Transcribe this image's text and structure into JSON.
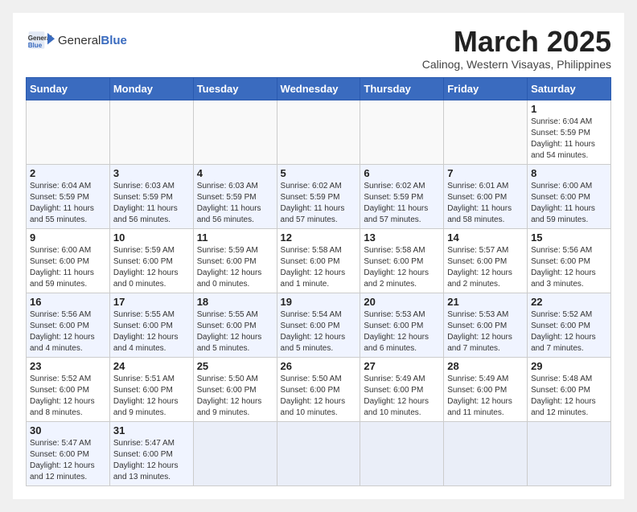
{
  "logo": {
    "text_general": "General",
    "text_blue": "Blue"
  },
  "header": {
    "month_title": "March 2025",
    "subtitle": "Calinog, Western Visayas, Philippines"
  },
  "weekdays": [
    "Sunday",
    "Monday",
    "Tuesday",
    "Wednesday",
    "Thursday",
    "Friday",
    "Saturday"
  ],
  "days": [
    {
      "num": "",
      "info": ""
    },
    {
      "num": "",
      "info": ""
    },
    {
      "num": "",
      "info": ""
    },
    {
      "num": "",
      "info": ""
    },
    {
      "num": "",
      "info": ""
    },
    {
      "num": "",
      "info": ""
    },
    {
      "num": "1",
      "info": "Sunrise: 6:04 AM\nSunset: 5:59 PM\nDaylight: 11 hours\nand 54 minutes."
    },
    {
      "num": "2",
      "info": "Sunrise: 6:04 AM\nSunset: 5:59 PM\nDaylight: 11 hours\nand 55 minutes."
    },
    {
      "num": "3",
      "info": "Sunrise: 6:03 AM\nSunset: 5:59 PM\nDaylight: 11 hours\nand 56 minutes."
    },
    {
      "num": "4",
      "info": "Sunrise: 6:03 AM\nSunset: 5:59 PM\nDaylight: 11 hours\nand 56 minutes."
    },
    {
      "num": "5",
      "info": "Sunrise: 6:02 AM\nSunset: 5:59 PM\nDaylight: 11 hours\nand 57 minutes."
    },
    {
      "num": "6",
      "info": "Sunrise: 6:02 AM\nSunset: 5:59 PM\nDaylight: 11 hours\nand 57 minutes."
    },
    {
      "num": "7",
      "info": "Sunrise: 6:01 AM\nSunset: 6:00 PM\nDaylight: 11 hours\nand 58 minutes."
    },
    {
      "num": "8",
      "info": "Sunrise: 6:00 AM\nSunset: 6:00 PM\nDaylight: 11 hours\nand 59 minutes."
    },
    {
      "num": "9",
      "info": "Sunrise: 6:00 AM\nSunset: 6:00 PM\nDaylight: 11 hours\nand 59 minutes."
    },
    {
      "num": "10",
      "info": "Sunrise: 5:59 AM\nSunset: 6:00 PM\nDaylight: 12 hours\nand 0 minutes."
    },
    {
      "num": "11",
      "info": "Sunrise: 5:59 AM\nSunset: 6:00 PM\nDaylight: 12 hours\nand 0 minutes."
    },
    {
      "num": "12",
      "info": "Sunrise: 5:58 AM\nSunset: 6:00 PM\nDaylight: 12 hours\nand 1 minute."
    },
    {
      "num": "13",
      "info": "Sunrise: 5:58 AM\nSunset: 6:00 PM\nDaylight: 12 hours\nand 2 minutes."
    },
    {
      "num": "14",
      "info": "Sunrise: 5:57 AM\nSunset: 6:00 PM\nDaylight: 12 hours\nand 2 minutes."
    },
    {
      "num": "15",
      "info": "Sunrise: 5:56 AM\nSunset: 6:00 PM\nDaylight: 12 hours\nand 3 minutes."
    },
    {
      "num": "16",
      "info": "Sunrise: 5:56 AM\nSunset: 6:00 PM\nDaylight: 12 hours\nand 4 minutes."
    },
    {
      "num": "17",
      "info": "Sunrise: 5:55 AM\nSunset: 6:00 PM\nDaylight: 12 hours\nand 4 minutes."
    },
    {
      "num": "18",
      "info": "Sunrise: 5:55 AM\nSunset: 6:00 PM\nDaylight: 12 hours\nand 5 minutes."
    },
    {
      "num": "19",
      "info": "Sunrise: 5:54 AM\nSunset: 6:00 PM\nDaylight: 12 hours\nand 5 minutes."
    },
    {
      "num": "20",
      "info": "Sunrise: 5:53 AM\nSunset: 6:00 PM\nDaylight: 12 hours\nand 6 minutes."
    },
    {
      "num": "21",
      "info": "Sunrise: 5:53 AM\nSunset: 6:00 PM\nDaylight: 12 hours\nand 7 minutes."
    },
    {
      "num": "22",
      "info": "Sunrise: 5:52 AM\nSunset: 6:00 PM\nDaylight: 12 hours\nand 7 minutes."
    },
    {
      "num": "23",
      "info": "Sunrise: 5:52 AM\nSunset: 6:00 PM\nDaylight: 12 hours\nand 8 minutes."
    },
    {
      "num": "24",
      "info": "Sunrise: 5:51 AM\nSunset: 6:00 PM\nDaylight: 12 hours\nand 9 minutes."
    },
    {
      "num": "25",
      "info": "Sunrise: 5:50 AM\nSunset: 6:00 PM\nDaylight: 12 hours\nand 9 minutes."
    },
    {
      "num": "26",
      "info": "Sunrise: 5:50 AM\nSunset: 6:00 PM\nDaylight: 12 hours\nand 10 minutes."
    },
    {
      "num": "27",
      "info": "Sunrise: 5:49 AM\nSunset: 6:00 PM\nDaylight: 12 hours\nand 10 minutes."
    },
    {
      "num": "28",
      "info": "Sunrise: 5:49 AM\nSunset: 6:00 PM\nDaylight: 12 hours\nand 11 minutes."
    },
    {
      "num": "29",
      "info": "Sunrise: 5:48 AM\nSunset: 6:00 PM\nDaylight: 12 hours\nand 12 minutes."
    },
    {
      "num": "30",
      "info": "Sunrise: 5:47 AM\nSunset: 6:00 PM\nDaylight: 12 hours\nand 12 minutes."
    },
    {
      "num": "31",
      "info": "Sunrise: 5:47 AM\nSunset: 6:00 PM\nDaylight: 12 hours\nand 13 minutes."
    },
    {
      "num": "",
      "info": ""
    },
    {
      "num": "",
      "info": ""
    },
    {
      "num": "",
      "info": ""
    },
    {
      "num": "",
      "info": ""
    },
    {
      "num": "",
      "info": ""
    }
  ]
}
